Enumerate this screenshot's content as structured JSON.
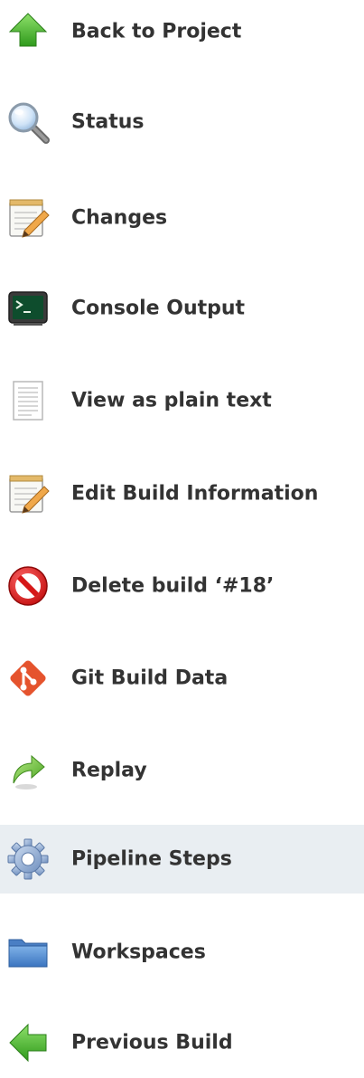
{
  "tasks": [
    {
      "label": "Back to Project",
      "icon": "up-arrow-icon"
    },
    {
      "label": "Status",
      "icon": "search-icon"
    },
    {
      "label": "Changes",
      "icon": "notepad-icon"
    },
    {
      "label": "Console Output",
      "icon": "terminal-icon"
    },
    {
      "label": "View as plain text",
      "icon": "document-icon"
    },
    {
      "label": "Edit Build Information",
      "icon": "notepad-icon"
    },
    {
      "label": "Delete build ‘#18’",
      "icon": "no-entry-icon"
    },
    {
      "label": "Git Build Data",
      "icon": "git-icon"
    },
    {
      "label": "Replay",
      "icon": "redo-arrow-icon"
    },
    {
      "label": "Pipeline Steps",
      "icon": "gear-icon",
      "active": true
    },
    {
      "label": "Workspaces",
      "icon": "folder-icon"
    },
    {
      "label": "Previous Build",
      "icon": "left-arrow-icon"
    }
  ],
  "colors": {
    "text": "#333333",
    "active_background": "#e9eef2"
  }
}
